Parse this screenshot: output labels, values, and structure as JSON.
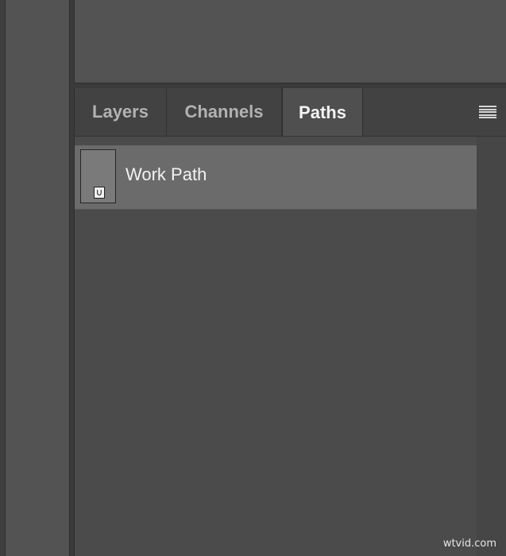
{
  "panel": {
    "tabs": [
      {
        "label": "Layers",
        "active": false
      },
      {
        "label": "Channels",
        "active": false
      },
      {
        "label": "Paths",
        "active": true
      }
    ],
    "menu_icon": "panel-menu-icon"
  },
  "paths": [
    {
      "name": "Work Path",
      "thumbnail_icon": "path-thumbnail-icon",
      "selected": true
    }
  ],
  "watermark": "wtvid.com",
  "colors": {
    "panel_bg": "#4b4b4b",
    "active_tab_bg": "#4f4f4f",
    "selected_row_bg": "#6b6b6b",
    "active_tab_text": "#f4f4f4",
    "inactive_tab_text": "#b2b2b2"
  }
}
